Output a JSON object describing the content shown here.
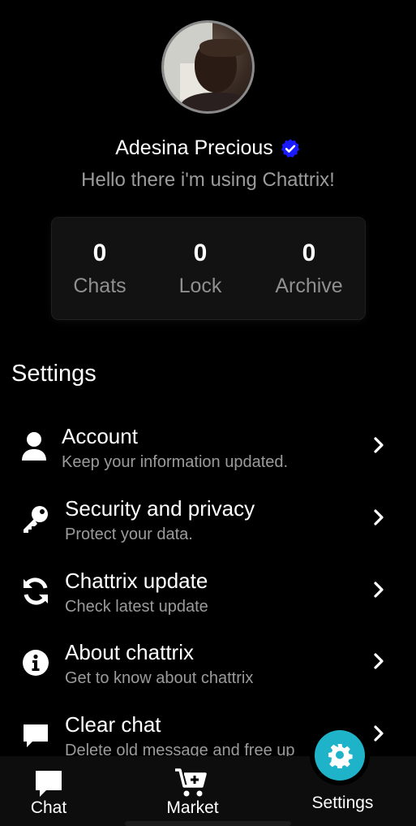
{
  "profile": {
    "name": "Adesina Precious",
    "status": "Hello there i'm using Chattrix!"
  },
  "stats": [
    {
      "value": "0",
      "label": "Chats"
    },
    {
      "value": "0",
      "label": "Lock"
    },
    {
      "value": "0",
      "label": "Archive"
    }
  ],
  "settings": {
    "title": "Settings",
    "items": [
      {
        "icon": "user-icon",
        "title": "Account",
        "subtitle": "Keep your information updated."
      },
      {
        "icon": "key-icon",
        "title": "Security and privacy",
        "subtitle": "Protect your data."
      },
      {
        "icon": "sync-icon",
        "title": "Chattrix update",
        "subtitle": "Check latest update"
      },
      {
        "icon": "info-icon",
        "title": "About chattrix",
        "subtitle": "Get to know about chattrix"
      },
      {
        "icon": "message-icon",
        "title": "Clear chat",
        "subtitle": "Delete old message and free up"
      }
    ]
  },
  "nav": {
    "chat": "Chat",
    "market": "Market",
    "settings": "Settings"
  },
  "colors": {
    "accent": "#1fb3c9",
    "verified": "#1a1aff",
    "background": "#000000"
  }
}
